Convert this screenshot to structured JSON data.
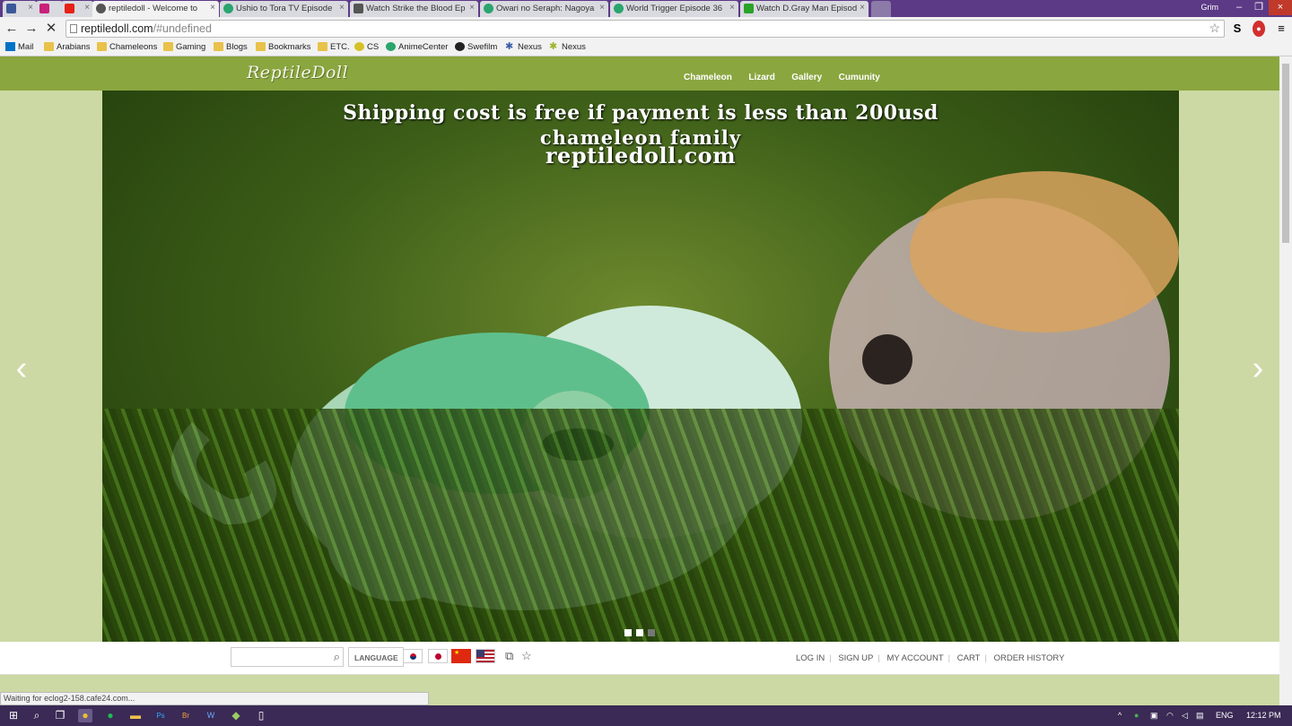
{
  "tabs": [
    {
      "title": "",
      "color": "#3b5998"
    },
    {
      "title": "",
      "color": "#c9207a"
    },
    {
      "title": "",
      "color": "#e62117"
    },
    {
      "title": "reptiledoll - Welcome to",
      "color": "#444444"
    },
    {
      "title": "Ushio to Tora TV Episode",
      "color": "#2aa56d"
    },
    {
      "title": "Watch Strike the Blood Ep",
      "color": "#555555"
    },
    {
      "title": "Owari no Seraph: Nagoya",
      "color": "#2aa56d"
    },
    {
      "title": "World Trigger Episode 36",
      "color": "#2aa56d"
    },
    {
      "title": "Watch D.Gray Man Episod",
      "color": "#29a329"
    }
  ],
  "window": {
    "user": "Grim"
  },
  "omnibox": {
    "url_host": "reptiledoll.com",
    "url_rest": "/#undefined"
  },
  "bookmarks": [
    {
      "label": "Mail",
      "icon": "mail-icon"
    },
    {
      "label": "Arabians",
      "icon": "folder-icon"
    },
    {
      "label": "Chameleons",
      "icon": "folder-icon"
    },
    {
      "label": "Gaming",
      "icon": "folder-icon"
    },
    {
      "label": "Blogs",
      "icon": "folder-icon"
    },
    {
      "label": "Bookmarks",
      "icon": "folder-icon"
    },
    {
      "label": "ETC.",
      "icon": "folder-icon"
    },
    {
      "label": "CS",
      "icon": "cs-icon"
    },
    {
      "label": "AnimeCenter",
      "icon": "animecenter-icon"
    },
    {
      "label": "Swefilm",
      "icon": "swefilm-icon"
    },
    {
      "label": "Nexus",
      "icon": "nexus-icon"
    },
    {
      "label": "Nexus",
      "icon": "nexus-icon"
    }
  ],
  "site": {
    "logo": "ReptileDoll",
    "nav": [
      "Chameleon",
      "Lizard",
      "Gallery",
      "Cumunity"
    ],
    "hero": {
      "line1": "Shipping cost is free if payment is less than 200usd",
      "line2": "chameleon  family",
      "line3": "reptiledoll.com"
    },
    "language_label": "LANGUAGE",
    "links": [
      "LOG IN",
      "SIGN UP",
      "MY ACCOUNT",
      "CART",
      "ORDER HISTORY"
    ]
  },
  "status_text": "Waiting for eclog2-158.cafe24.com...",
  "taskbar": {
    "lang": "ENG",
    "time": "12:12 PM"
  }
}
